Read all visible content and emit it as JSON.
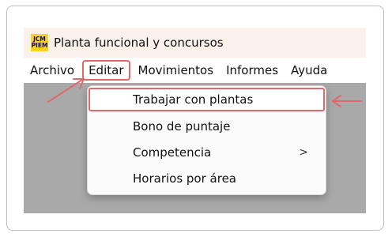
{
  "window": {
    "title": "Planta funcional y concursos",
    "logo_line1": "JCM",
    "logo_line2": "PIEM"
  },
  "menubar": {
    "items": [
      "Archivo",
      "Editar",
      "Movimientos",
      "Informes",
      "Ayuda"
    ],
    "active_index": 1
  },
  "dropdown": {
    "items": [
      {
        "label": "Trabajar con plantas",
        "highlighted": true
      },
      {
        "label": "Bono de puntaje"
      },
      {
        "label": "Competencia",
        "has_submenu": true,
        "submenu_glyph": ">"
      },
      {
        "label": "Horarios por área"
      }
    ]
  },
  "colors": {
    "annotation_red": "#e0696b",
    "titlebar_bg": "#f9f1ea",
    "workspace_gray": "#a9a9a9",
    "logo_yellow": "#ffd21f",
    "logo_text": "#0a0a6e"
  }
}
